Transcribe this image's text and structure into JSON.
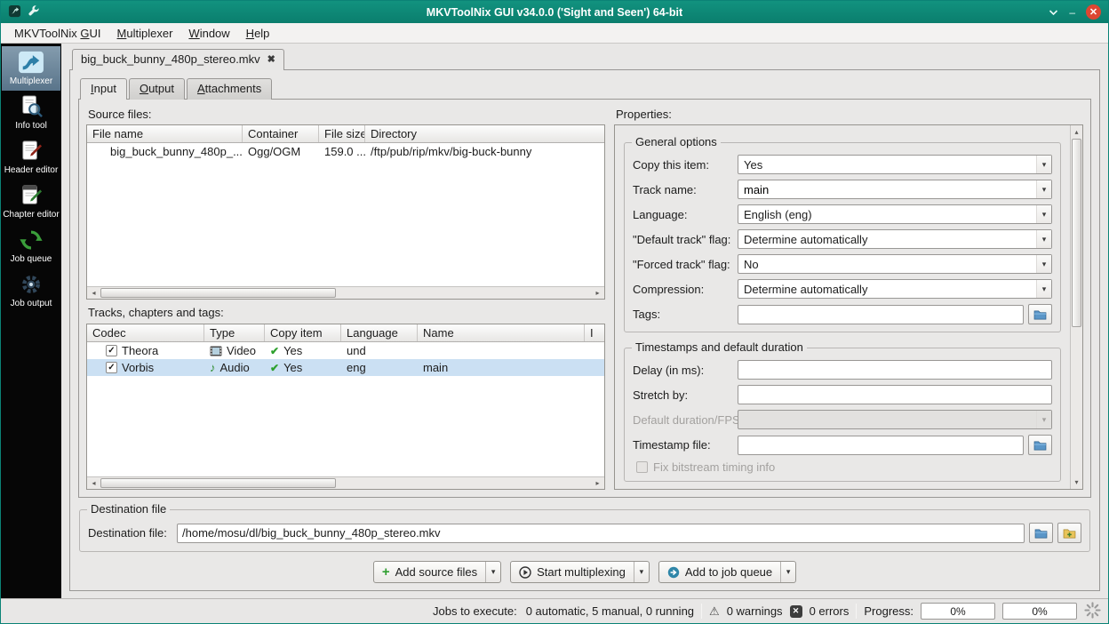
{
  "window": {
    "title": "MKVToolNix GUI v34.0.0 ('Sight and Seen') 64-bit"
  },
  "icons": {
    "window_close": "✕",
    "minimize": "–",
    "tab_close": "✖",
    "dropdown": "▾",
    "scroll_left": "◂",
    "scroll_right": "▸",
    "scroll_up": "▴",
    "scroll_down": "▾",
    "check": "✓",
    "yes_check": "✔",
    "note": "♪",
    "warning": "⚠",
    "error_x": "✕",
    "plus": "+"
  },
  "menubar": {
    "items": [
      {
        "pre": "MKVToolNix ",
        "key": "G",
        "post": "UI"
      },
      {
        "pre": "",
        "key": "M",
        "post": "ultiplexer"
      },
      {
        "pre": "",
        "key": "W",
        "post": "indow"
      },
      {
        "pre": "",
        "key": "H",
        "post": "elp"
      }
    ]
  },
  "sidebar": {
    "items": [
      {
        "label": "Multiplexer"
      },
      {
        "label": "Info tool"
      },
      {
        "label": "Header editor"
      },
      {
        "label": "Chapter editor"
      },
      {
        "label": "Job queue"
      },
      {
        "label": "Job output"
      }
    ]
  },
  "doc_tab": {
    "label": "big_buck_bunny_480p_stereo.mkv"
  },
  "tabs": {
    "input": {
      "key": "I",
      "post": "nput"
    },
    "output": {
      "key": "O",
      "post": "utput"
    },
    "attachments": {
      "key": "A",
      "post": "ttachments"
    }
  },
  "source_files": {
    "label": "Source files:",
    "columns": [
      "File name",
      "Container",
      "File size",
      "Directory"
    ],
    "rows": [
      {
        "name": "big_buck_bunny_480p_...",
        "container": "Ogg/OGM",
        "size": "159.0 ...",
        "directory": "/ftp/pub/rip/mkv/big-buck-bunny"
      }
    ]
  },
  "tracks": {
    "label": "Tracks, chapters and tags:",
    "columns": [
      "Codec",
      "Type",
      "Copy item",
      "Language",
      "Name",
      "I"
    ],
    "rows": [
      {
        "codec": "Theora",
        "type": "Video",
        "copy": "Yes",
        "language": "und",
        "name": ""
      },
      {
        "codec": "Vorbis",
        "type": "Audio",
        "copy": "Yes",
        "language": "eng",
        "name": "main"
      }
    ]
  },
  "properties": {
    "label": "Properties:",
    "general": {
      "title": "General options",
      "copy_item_label": "Copy this item:",
      "copy_item_value": "Yes",
      "track_name_label": "Track name:",
      "track_name_value": "main",
      "language_label": "Language:",
      "language_value": "English (eng)",
      "default_flag_label": "\"Default track\" flag:",
      "default_flag_value": "Determine automatically",
      "forced_flag_label": "\"Forced track\" flag:",
      "forced_flag_value": "No",
      "compression_label": "Compression:",
      "compression_value": "Determine automatically",
      "tags_label": "Tags:",
      "tags_value": ""
    },
    "timestamps": {
      "title": "Timestamps and default duration",
      "delay_label": "Delay (in ms):",
      "delay_value": "",
      "stretch_label": "Stretch by:",
      "stretch_value": "",
      "default_duration_label": "Default duration/FPS:",
      "default_duration_value": "",
      "timestamp_file_label": "Timestamp file:",
      "timestamp_file_value": "",
      "fix_bitstream_label": "Fix bitstream timing info"
    }
  },
  "destination": {
    "group_title": "Destination file",
    "label": "Destination file:",
    "value": "/home/mosu/dl/big_buck_bunny_480p_stereo.mkv"
  },
  "actions": {
    "add_source_files": "Add source files",
    "start_multiplexing": "Start multiplexing",
    "add_to_job_queue": "Add to job queue"
  },
  "statusbar": {
    "jobs_label": "Jobs to execute:",
    "jobs_value": "0 automatic, 5 manual, 0 running",
    "warnings": "0 warnings",
    "errors": "0 errors",
    "progress_label": "Progress:",
    "progress_left": "0%",
    "progress_right": "0%"
  }
}
